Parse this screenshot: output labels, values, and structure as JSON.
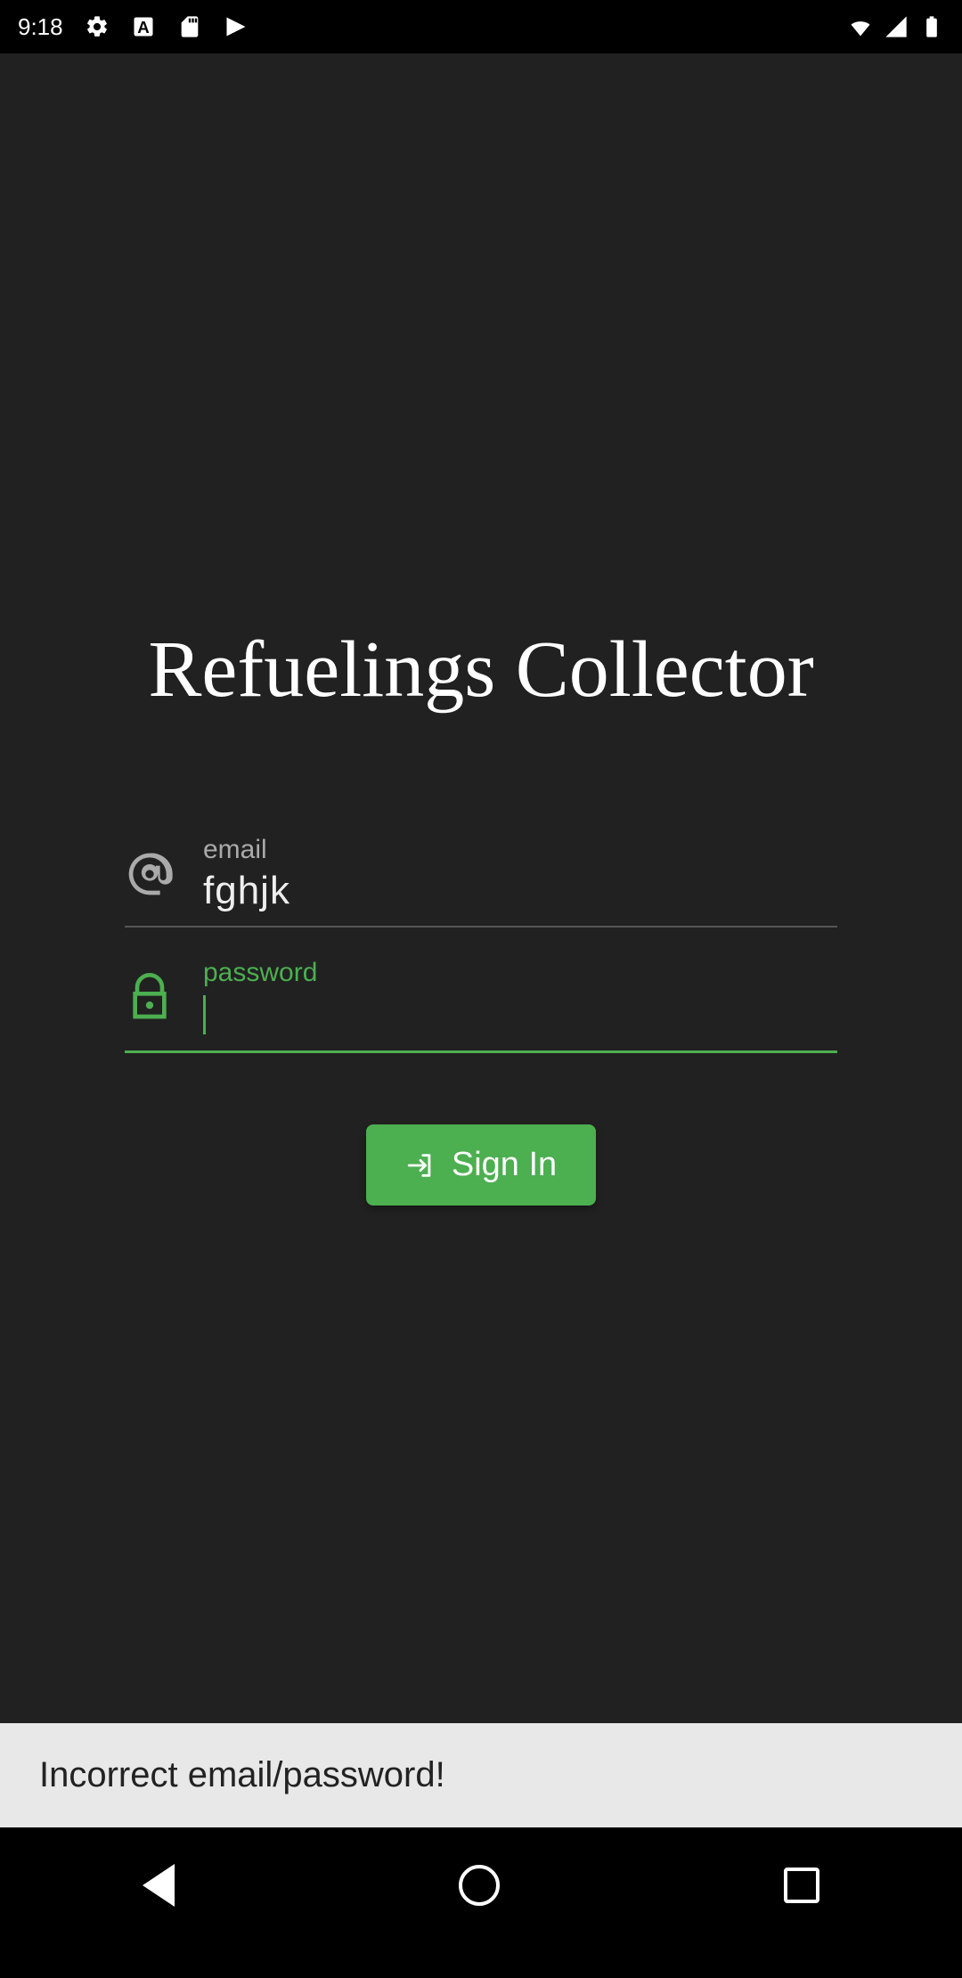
{
  "status": {
    "time": "9:18"
  },
  "app": {
    "title": "Refuelings Collector"
  },
  "form": {
    "email": {
      "label": "email",
      "value": "fghjk"
    },
    "password": {
      "label": "password",
      "value": ""
    },
    "submit_label": "Sign In"
  },
  "snackbar": {
    "message": "Incorrect email/password!"
  },
  "colors": {
    "accent": "#4caf50",
    "bg": "#212121"
  }
}
